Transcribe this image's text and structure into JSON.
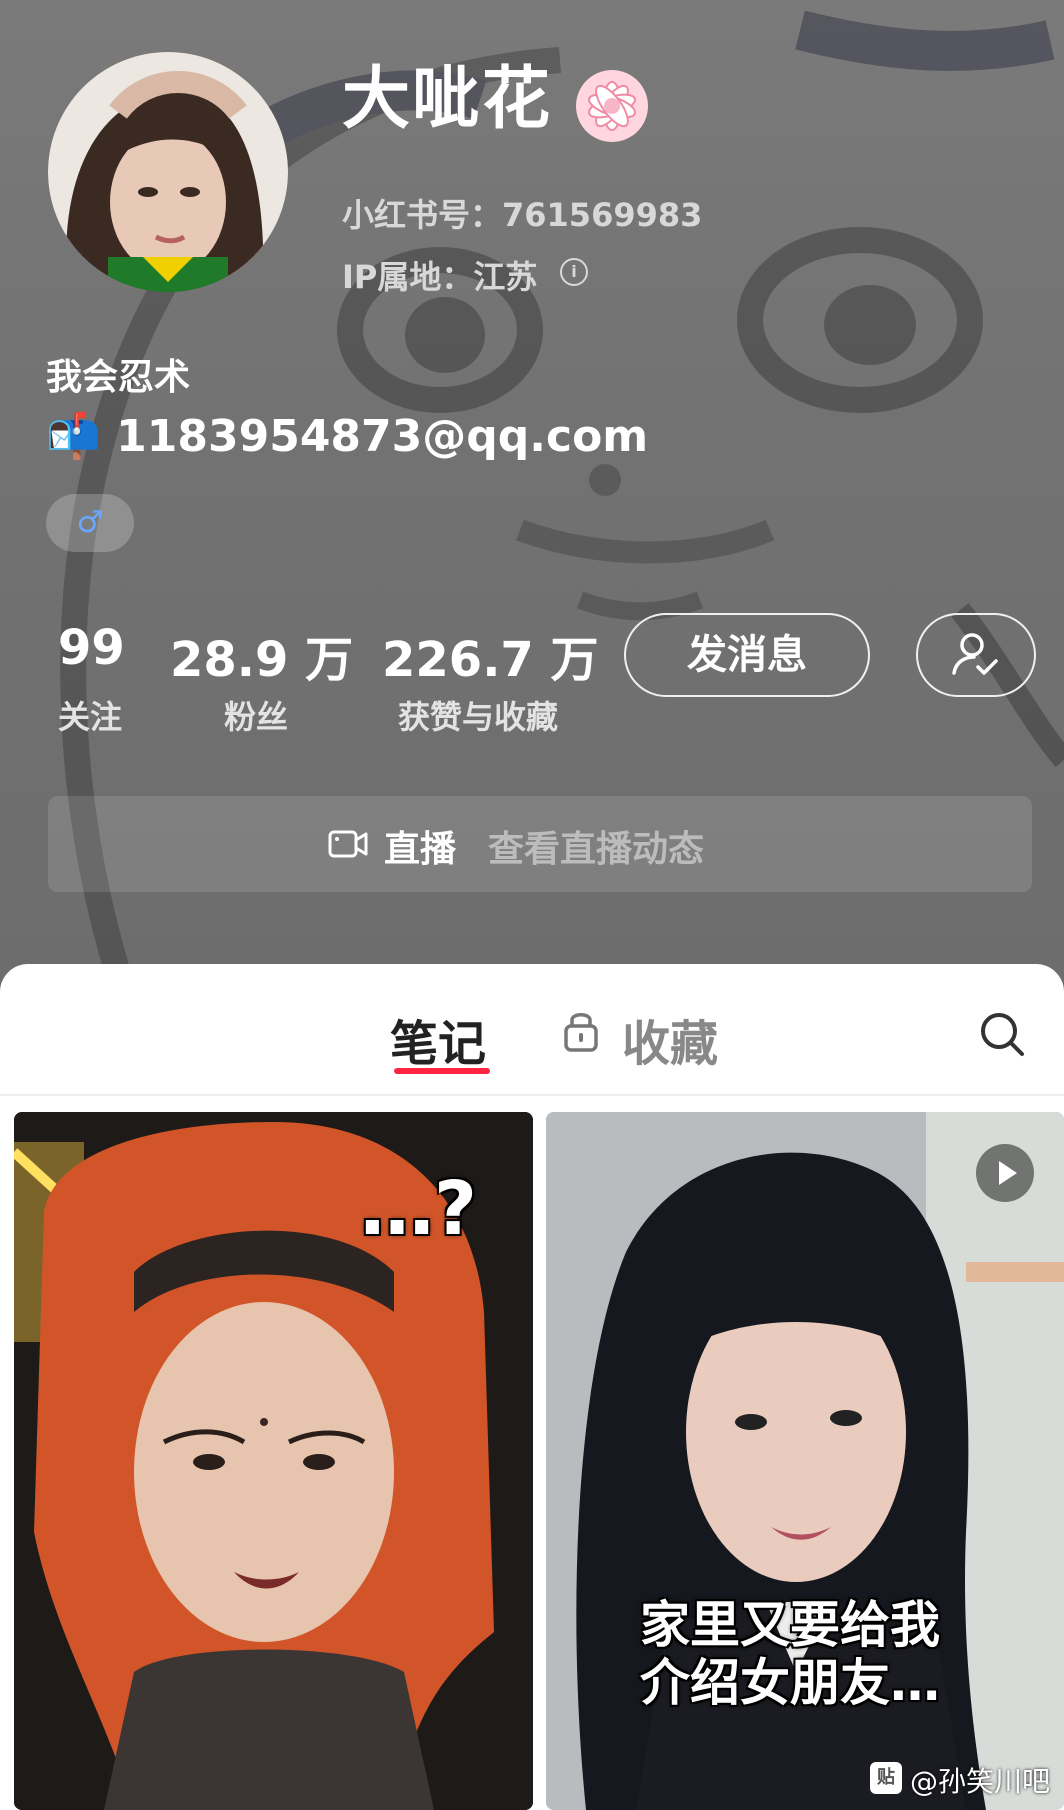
{
  "profile": {
    "nickname": "大呲花",
    "red_id": "小红书号：761569983",
    "ip_location": "IP属地：江苏",
    "bio_line1": "我会忍术",
    "bio_emoji": "📬",
    "bio_email": "1183954873@qq.com",
    "gender_symbol": "♂"
  },
  "stats": {
    "following_count": "99",
    "following_label": "关注",
    "followers_count": "28.9 万",
    "followers_label": "粉丝",
    "likes_count": "226.7 万",
    "likes_label": "获赞与收藏"
  },
  "actions": {
    "message_label": "发消息"
  },
  "live": {
    "label": "直播",
    "link": "查看直播动态"
  },
  "tabs": {
    "notes": "笔记",
    "collections": "收藏"
  },
  "notes": [
    {
      "overlay_text": "…?"
    },
    {
      "caption_line1": "家里又要给我",
      "caption_line2": "介绍女朋友…"
    }
  ],
  "watermark": "@孙笑川吧",
  "colors": {
    "accent": "#ff2442",
    "gender_blue": "#6aa8ff"
  }
}
